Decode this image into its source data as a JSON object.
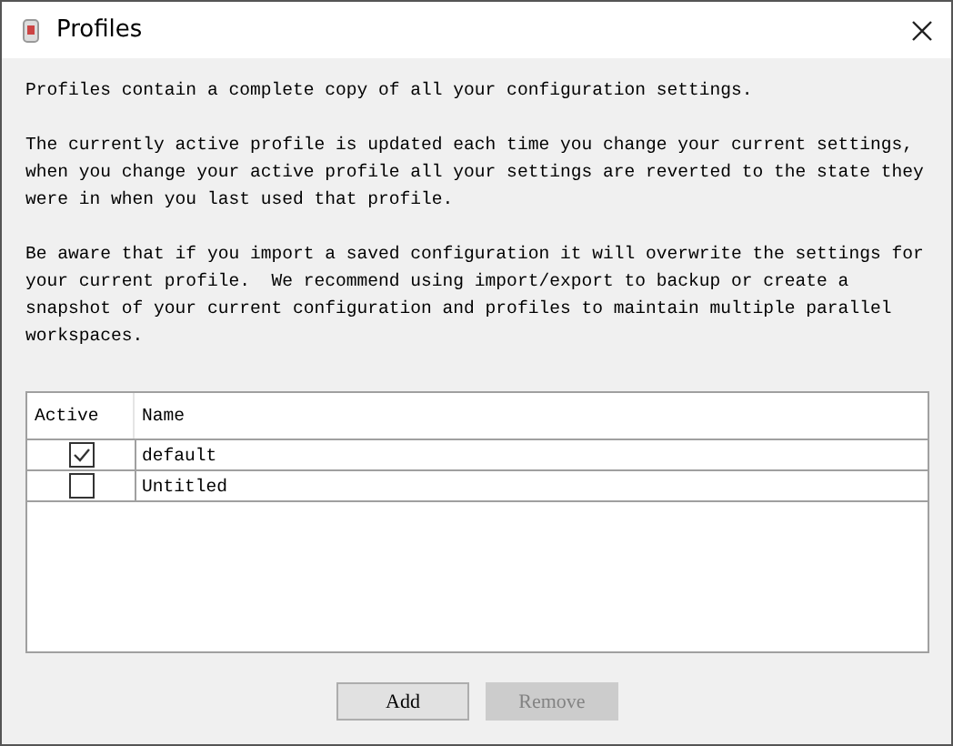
{
  "window": {
    "title": "Profiles"
  },
  "paragraphs": [
    "Profiles contain a complete copy of all your configuration settings.",
    "The currently active profile is updated each time you change your current settings, when you change your active profile all your settings are reverted to the state they were in when you last used that profile.",
    "Be aware that if you import a saved configuration it will overwrite the settings for your current profile.  We recommend using import/export to backup or create a snapshot of your current configuration and profiles to maintain multiple parallel workspaces."
  ],
  "table": {
    "columns": [
      "Active",
      "Name"
    ],
    "rows": [
      {
        "checked": true,
        "name": "default"
      },
      {
        "checked": false,
        "name": "Untitled"
      }
    ]
  },
  "buttons": [
    {
      "label": "Add",
      "disabled": false
    },
    {
      "label": "Remove",
      "disabled": true
    }
  ]
}
